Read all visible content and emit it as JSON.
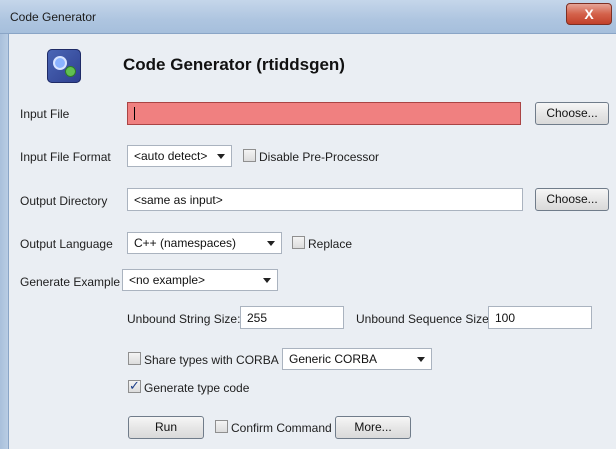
{
  "window": {
    "title": "Code Generator",
    "close_glyph": "X"
  },
  "header": {
    "title": "Code Generator (rtiddsgen)",
    "icon": "code-generator-app-icon"
  },
  "form": {
    "input_file": {
      "label": "Input File",
      "value": "",
      "choose": "Choose..."
    },
    "input_file_format": {
      "label": "Input File Format",
      "selected": "<auto detect>",
      "disable_preprocessor": {
        "label": "Disable Pre-Processor",
        "checked": false
      }
    },
    "output_directory": {
      "label": "Output Directory",
      "value": "<same as input>",
      "choose": "Choose..."
    },
    "output_language": {
      "label": "Output Language",
      "selected": "C++ (namespaces)",
      "replace": {
        "label": "Replace",
        "checked": false
      }
    },
    "generate_example": {
      "label": "Generate Example",
      "selected": "<no example>"
    },
    "unbound_string_size": {
      "label": "Unbound String Size:",
      "value": "255"
    },
    "unbound_sequence_size": {
      "label": "Unbound Sequence Size:",
      "value": "100"
    },
    "share_types": {
      "label": "Share types with CORBA",
      "checked": false,
      "corba_selected": "Generic CORBA"
    },
    "generate_type_code": {
      "label": "Generate type code",
      "checked": true
    },
    "run": "Run",
    "confirm_command": {
      "label": "Confirm Command",
      "checked": false
    },
    "more": "More..."
  },
  "colors": {
    "error_field": "#f08080",
    "window_bg": "#eaeef3"
  }
}
